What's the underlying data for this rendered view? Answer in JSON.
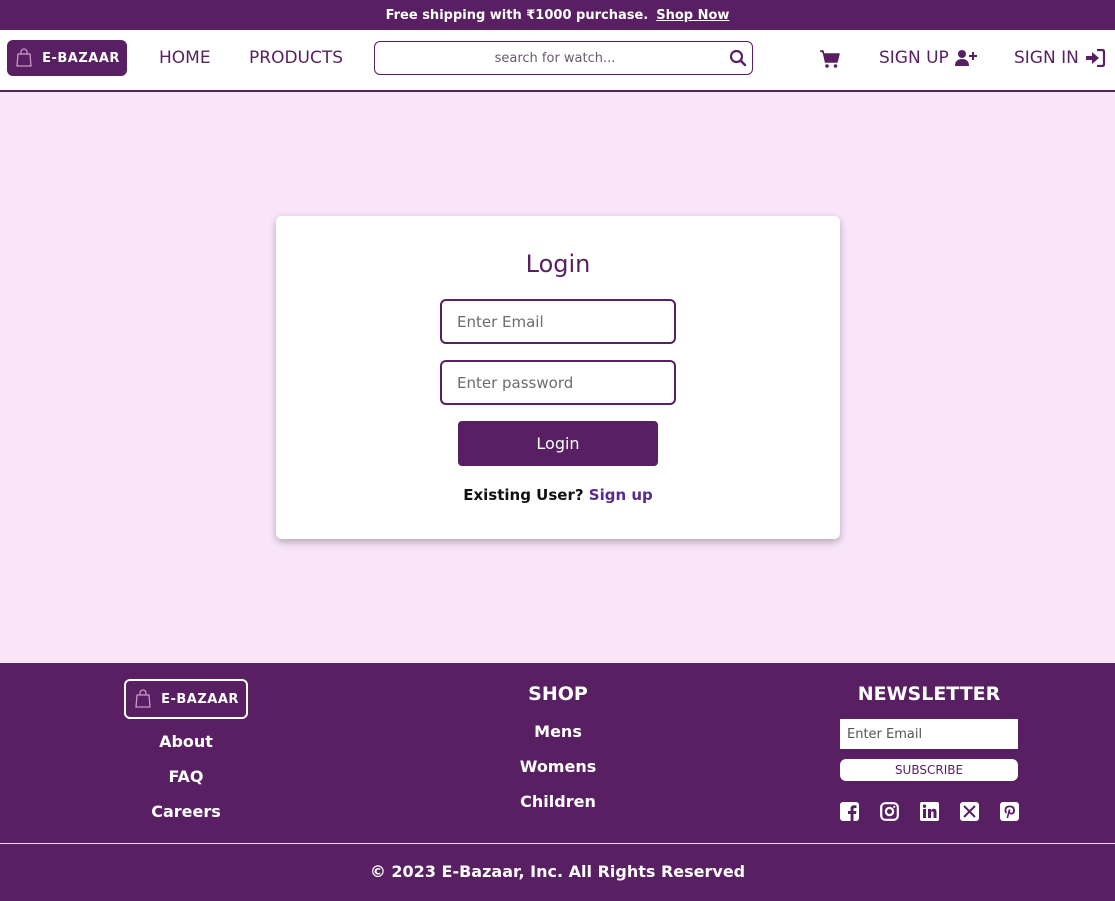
{
  "colors": {
    "brand": "#581f62",
    "page_bg": "#f8e5f9",
    "link": "#5a2a8a"
  },
  "topbar": {
    "promo": "Free shipping with ₹1000 purchase.",
    "shop_now": "Shop Now"
  },
  "header": {
    "logo_text": "E-BAZAAR",
    "nav": {
      "home": "HOME",
      "products": "PRODUCTS",
      "sign_up": "SIGN UP",
      "sign_in": "SIGN IN"
    },
    "search": {
      "placeholder": "search for watch...",
      "value": ""
    },
    "icons": [
      "shopping-bag-icon",
      "search-icon",
      "cart-icon",
      "user-plus-icon",
      "sign-in-icon"
    ]
  },
  "login": {
    "title": "Login",
    "email_placeholder": "Enter Email",
    "password_placeholder": "Enter password",
    "button_label": "Login",
    "existing_text": "Existing User?",
    "signup_link": "Sign up"
  },
  "footer": {
    "logo_text": "E-BAZAAR",
    "company_links": [
      "About",
      "FAQ",
      "Careers"
    ],
    "shop": {
      "heading": "SHOP",
      "links": [
        "Mens",
        "Womens",
        "Children"
      ]
    },
    "newsletter": {
      "heading": "NEWSLETTER",
      "email_placeholder": "Enter Email",
      "subscribe_label": "SUBSCRIBE",
      "socials": [
        "facebook-icon",
        "instagram-icon",
        "linkedin-icon",
        "x-twitter-icon",
        "pinterest-icon"
      ]
    },
    "copyright": "© 2023 E-Bazaar, Inc. All Rights Reserved"
  }
}
